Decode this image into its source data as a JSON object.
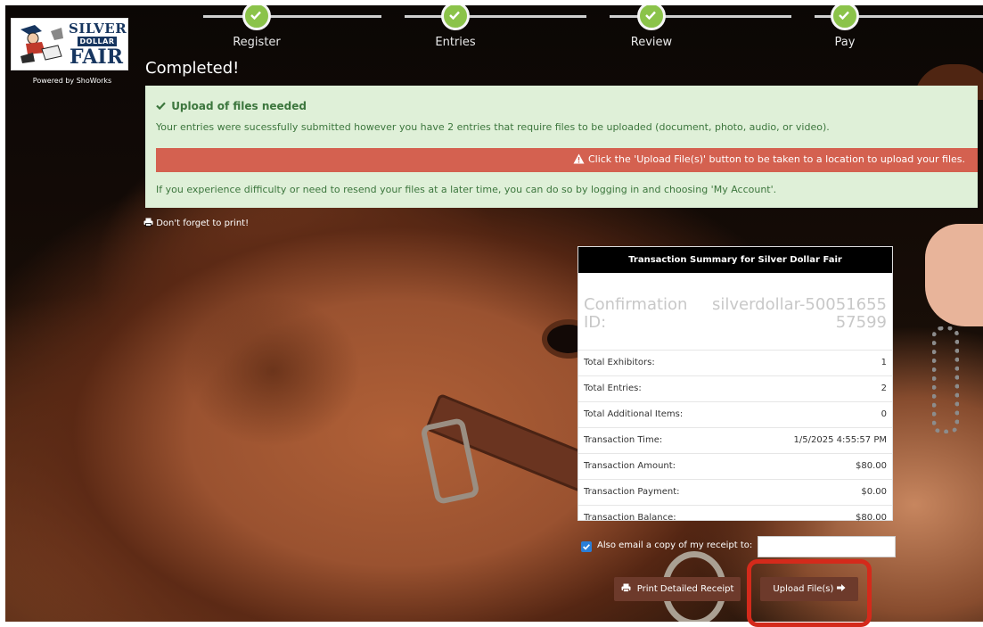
{
  "logo": {
    "line1": "SILVER",
    "line2": "DOLLAR",
    "line3": "FAIR",
    "powered_by": "Powered by ShoWorks"
  },
  "stepper": {
    "steps": [
      {
        "label": "Register",
        "status": "complete"
      },
      {
        "label": "Entries",
        "status": "complete"
      },
      {
        "label": "Review",
        "status": "complete"
      },
      {
        "label": "Pay",
        "status": "complete"
      }
    ]
  },
  "page_title": "Completed!",
  "alert": {
    "heading": "Upload of files needed",
    "message": "Your entries were sucessfully submitted however you have 2 entries that require files to be uploaded (document, photo, audio, or video).",
    "warning": "Click the 'Upload File(s)' button to be taken to a location to upload your files.",
    "footer": "If you experience difficulty or need to resend your files at a later time, you can do so by logging in and choosing 'My Account'."
  },
  "print_reminder": "Don't forget to print!",
  "summary": {
    "title": "Transaction Summary for Silver Dollar Fair",
    "confirmation_label": "Confirmation ID:",
    "confirmation_id": "silverdollar-5005165557599",
    "rows": [
      {
        "label": "Total Exhibitors:",
        "value": "1"
      },
      {
        "label": "Total Entries:",
        "value": "2"
      },
      {
        "label": "Total Additional Items:",
        "value": "0"
      },
      {
        "label": "Transaction Time:",
        "value": "1/5/2025 4:55:57 PM"
      },
      {
        "label": "Transaction Amount:",
        "value": "$80.00"
      },
      {
        "label": "Transaction Payment:",
        "value": "$0.00"
      },
      {
        "label": "Transaction Balance:",
        "value": "$80.00"
      }
    ]
  },
  "email_receipt": {
    "label": "Also email a copy of my receipt to:",
    "checked": true,
    "value": ""
  },
  "buttons": {
    "print": "Print Detailed Receipt",
    "upload": "Upload File(s)"
  },
  "colors": {
    "step_complete": "#8bc34a",
    "alert_bg": "#dff0d8",
    "alert_text": "#3c763d",
    "warning_bg": "#d46150",
    "button_bg": "#6d3a2b",
    "highlight": "#d42a1b"
  }
}
